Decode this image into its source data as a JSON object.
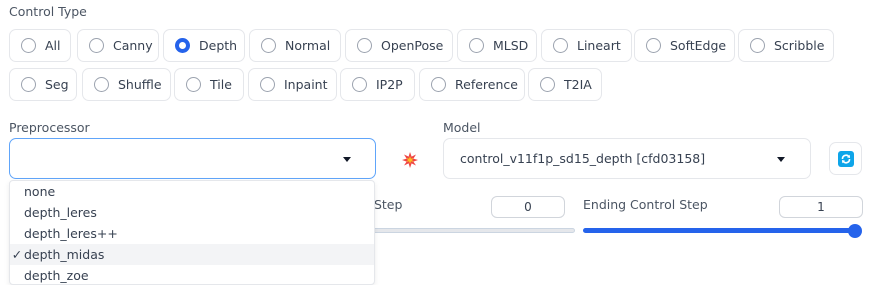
{
  "control_type": {
    "label": "Control Type",
    "options": [
      "All",
      "Canny",
      "Depth",
      "Normal",
      "OpenPose",
      "MLSD",
      "Lineart",
      "SoftEdge",
      "Scribble",
      "Seg",
      "Shuffle",
      "Tile",
      "Inpaint",
      "IP2P",
      "Reference",
      "T2IA"
    ],
    "selected": "Depth"
  },
  "preprocessor": {
    "label": "Preprocessor",
    "value": "",
    "options": [
      "none",
      "depth_leres",
      "depth_leres++",
      "depth_midas",
      "depth_zoe"
    ],
    "selected": "depth_midas",
    "check_mark": "✓"
  },
  "model": {
    "label": "Model",
    "value": "control_v11f1p_sd15_depth [cfd03158]"
  },
  "starting_step": {
    "label_partial": "rol Step",
    "value": "0",
    "fraction": 0.0
  },
  "ending_step": {
    "label": "Ending Control Step",
    "value": "1",
    "fraction": 1.0
  },
  "colors": {
    "accent": "#2563eb",
    "run_icon": "#ef4444",
    "refresh_icon": "#0ea5e9"
  },
  "icons": {
    "run": "explosion-icon",
    "refresh": "refresh-icon"
  }
}
